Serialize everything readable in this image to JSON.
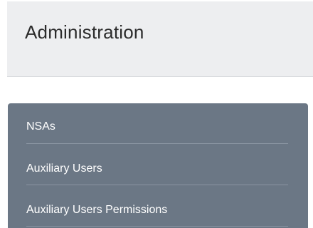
{
  "header": {
    "title": "Administration"
  },
  "menu": {
    "items": [
      {
        "label": "NSAs"
      },
      {
        "label": "Auxiliary Users"
      },
      {
        "label": "Auxiliary Users Permissions"
      }
    ]
  },
  "colors": {
    "header_bg": "#edeef0",
    "menu_bg": "#6b7785",
    "menu_text": "#ffffff",
    "title_text": "#2b2b2b"
  }
}
